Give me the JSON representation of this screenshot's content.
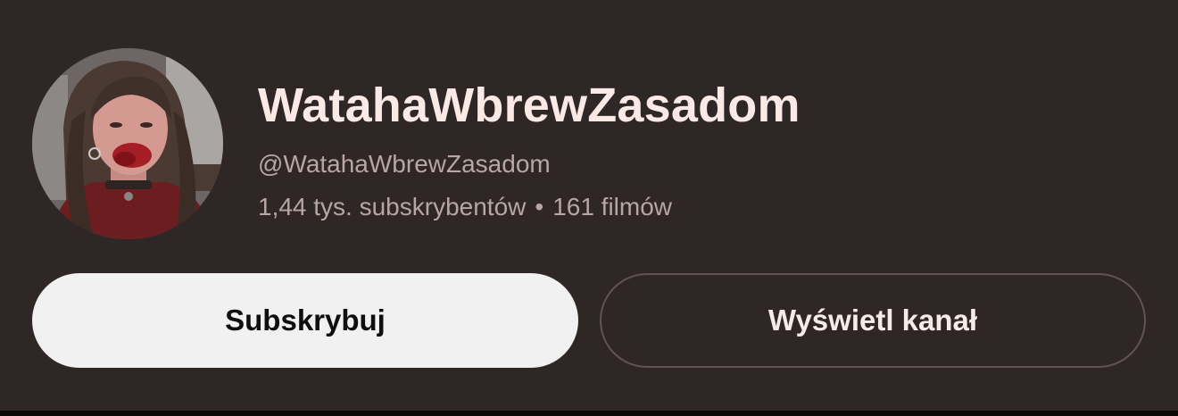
{
  "channel": {
    "name": "WatahaWbrewZasadom",
    "handle": "@WatahaWbrewZasadom",
    "subscribers": "1,44 tys. subskrybentów",
    "separator": "•",
    "videos": "161 filmów"
  },
  "actions": {
    "subscribe_label": "Subskrybuj",
    "view_channel_label": "Wyświetl kanał"
  },
  "colors": {
    "background": "#2f2726",
    "name_text": "#fbe9e6",
    "secondary_text": "#b7a6a3",
    "subscribe_bg": "#f1f1f1",
    "view_border": "#5e5553"
  }
}
